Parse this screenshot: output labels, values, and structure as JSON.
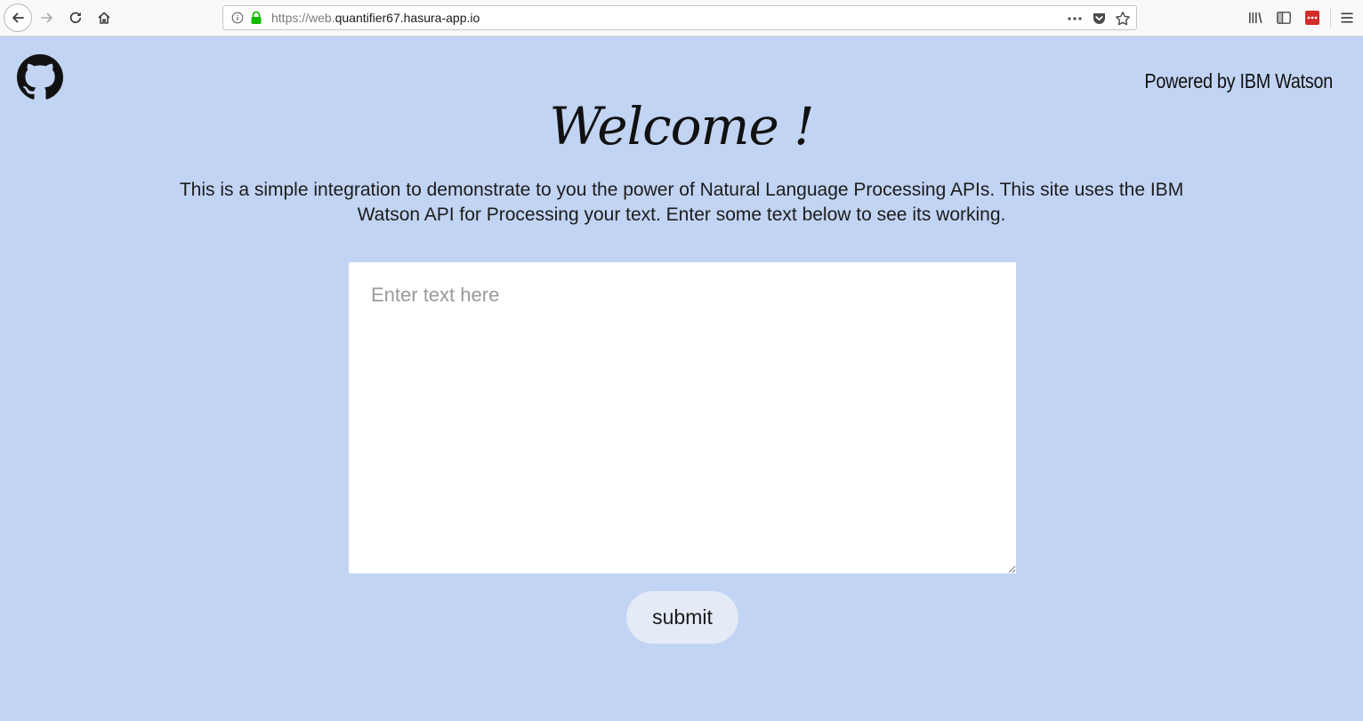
{
  "browser": {
    "url_prefix": "https://web.",
    "url_domain": "quantifier67.hasura-app.io",
    "icons": {
      "back": "back-arrow-icon",
      "forward": "forward-arrow-icon",
      "reload": "reload-icon",
      "home": "home-icon",
      "info": "info-icon",
      "lock": "lock-icon",
      "more": "more-dots-icon",
      "pocket": "pocket-icon",
      "bookmark": "star-icon",
      "library": "library-icon",
      "sidebar": "sidebar-icon",
      "extension": "lastpass-icon",
      "menu": "hamburger-menu-icon"
    },
    "colors": {
      "lock": "#12bc00",
      "extension": "#d32d27"
    }
  },
  "page": {
    "powered_by": "Powered by IBM Watson",
    "title": "Welcome !",
    "intro": "This is a simple integration to demonstrate to you the power of Natural Language Processing APIs. This site uses the IBM Watson API for Processing your text. Enter some text below to see its working.",
    "input": {
      "placeholder": "Enter text here",
      "value": ""
    },
    "submit_label": "submit",
    "github_icon": "github-icon",
    "colors": {
      "background": "#c2d4f3",
      "button": "#e4eaf6"
    }
  }
}
